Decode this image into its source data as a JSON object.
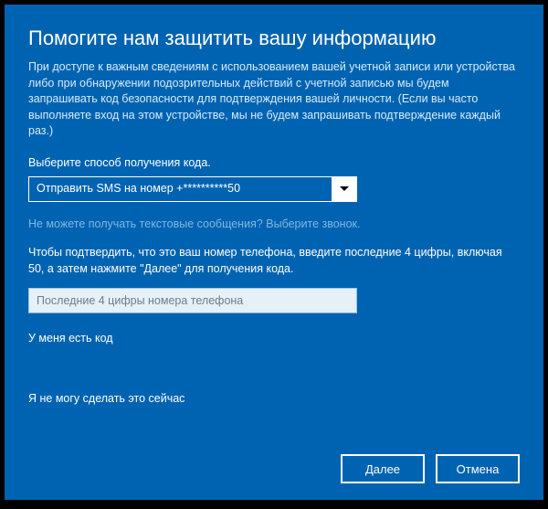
{
  "title": "Помогите нам защитить вашу информацию",
  "description": "При доступе к важным сведениям с использованием вашей учетной записи или устройства либо при обнаружении подозрительных действий с учетной записью мы будем запрашивать код безопасности для подтверждения вашей личности. (Если вы часто выполняете вход на этом устройстве, мы не будем запрашивать подтверждение каждый раз.)",
  "select_label": "Выберите способ получения кода.",
  "select_value": "Отправить SMS на номер +**********50",
  "help_text": "Не можете получать текстовые сообщения? Выберите звонок.",
  "confirm_instructions": "Чтобы подтвердить, что это ваш номер телефона, введите последние 4 цифры, включая 50, а затем нажмите \"Далее\" для получения кода.",
  "input_placeholder": "Последние 4 цифры номера телефона",
  "have_code_link": "У меня есть код",
  "cannot_now_link": "Я не могу сделать это сейчас",
  "buttons": {
    "next": "Далее",
    "cancel": "Отмена"
  }
}
